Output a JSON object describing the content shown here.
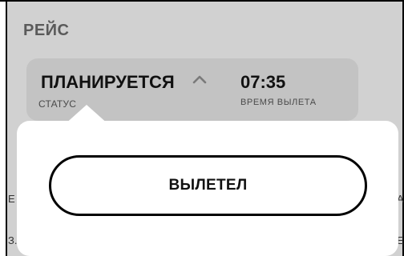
{
  "section": {
    "title": "РЕЙС"
  },
  "flight": {
    "status_value": "ПЛАНИРУЕТСЯ",
    "status_caption": "СТАТУС",
    "time_value": "07:35",
    "time_caption": "ВРЕМЯ ВЫЛЕТА"
  },
  "popover": {
    "option_label": "ВЫЛЕТЕЛ"
  },
  "edges": {
    "left_1": "Е",
    "left_2": "З.",
    "right_1": "А",
    "right_2": "Е"
  },
  "colors": {
    "background": "#d1d1d1",
    "card": "#c3c3c3",
    "popover": "#ffffff",
    "text": "#111111",
    "muted": "#5a5a5a"
  },
  "icons": {
    "chevron": "chevron-up-icon"
  }
}
